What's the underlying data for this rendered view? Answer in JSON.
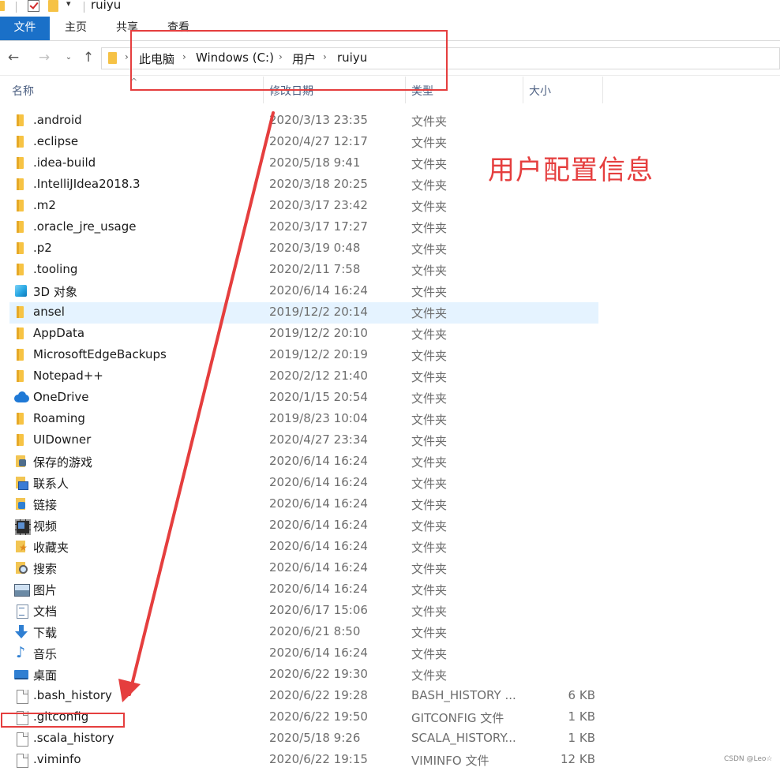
{
  "window": {
    "title": "ruiyu",
    "quick_access_glyph": "▾"
  },
  "ribbon": {
    "tabs": [
      {
        "label": "文件",
        "active": true
      },
      {
        "label": "主页"
      },
      {
        "label": "共享"
      },
      {
        "label": "查看"
      }
    ]
  },
  "nav": {
    "back_icon": "←",
    "forward_icon": "→",
    "recent_icon": "⌄",
    "up_icon": "↑",
    "separator_glyph": "›",
    "breadcrumb": [
      "此电脑",
      "Windows (C:)",
      "用户",
      "ruiyu"
    ]
  },
  "columns": {
    "name": "名称",
    "date": "修改日期",
    "type": "类型",
    "size": "大小",
    "sort_glyph": "^"
  },
  "files": [
    {
      "name": ".android",
      "date": "2020/3/13 23:35",
      "type": "文件夹",
      "size": "",
      "icon": "folder-icon"
    },
    {
      "name": ".eclipse",
      "date": "2020/4/27 12:17",
      "type": "文件夹",
      "size": "",
      "icon": "folder-icon"
    },
    {
      "name": ".idea-build",
      "date": "2020/5/18 9:41",
      "type": "文件夹",
      "size": "",
      "icon": "folder-icon"
    },
    {
      "name": ".IntelliJIdea2018.3",
      "date": "2020/3/18 20:25",
      "type": "文件夹",
      "size": "",
      "icon": "folder-icon"
    },
    {
      "name": ".m2",
      "date": "2020/3/17 23:42",
      "type": "文件夹",
      "size": "",
      "icon": "folder-icon"
    },
    {
      "name": ".oracle_jre_usage",
      "date": "2020/3/17 17:27",
      "type": "文件夹",
      "size": "",
      "icon": "folder-icon"
    },
    {
      "name": ".p2",
      "date": "2020/3/19 0:48",
      "type": "文件夹",
      "size": "",
      "icon": "folder-icon"
    },
    {
      "name": ".tooling",
      "date": "2020/2/11 7:58",
      "type": "文件夹",
      "size": "",
      "icon": "folder-icon"
    },
    {
      "name": "3D 对象",
      "date": "2020/6/14 16:24",
      "type": "文件夹",
      "size": "",
      "icon": "3d-objects-icon"
    },
    {
      "name": "ansel",
      "date": "2019/12/2 20:14",
      "type": "文件夹",
      "size": "",
      "icon": "folder-icon",
      "selected": true
    },
    {
      "name": "AppData",
      "date": "2019/12/2 20:10",
      "type": "文件夹",
      "size": "",
      "icon": "folder-icon"
    },
    {
      "name": "MicrosoftEdgeBackups",
      "date": "2019/12/2 20:19",
      "type": "文件夹",
      "size": "",
      "icon": "folder-icon"
    },
    {
      "name": "Notepad++",
      "date": "2020/2/12 21:40",
      "type": "文件夹",
      "size": "",
      "icon": "folder-icon"
    },
    {
      "name": "OneDrive",
      "date": "2020/1/15 20:54",
      "type": "文件夹",
      "size": "",
      "icon": "onedrive-cloud-icon"
    },
    {
      "name": "Roaming",
      "date": "2019/8/23 10:04",
      "type": "文件夹",
      "size": "",
      "icon": "folder-icon"
    },
    {
      "name": "UIDowner",
      "date": "2020/4/27 23:34",
      "type": "文件夹",
      "size": "",
      "icon": "folder-icon"
    },
    {
      "name": "保存的游戏",
      "date": "2020/6/14 16:24",
      "type": "文件夹",
      "size": "",
      "icon": "saved-games-icon"
    },
    {
      "name": "联系人",
      "date": "2020/6/14 16:24",
      "type": "文件夹",
      "size": "",
      "icon": "contacts-icon"
    },
    {
      "name": "链接",
      "date": "2020/6/14 16:24",
      "type": "文件夹",
      "size": "",
      "icon": "links-icon"
    },
    {
      "name": "视频",
      "date": "2020/6/14 16:24",
      "type": "文件夹",
      "size": "",
      "icon": "videos-icon"
    },
    {
      "name": "收藏夹",
      "date": "2020/6/14 16:24",
      "type": "文件夹",
      "size": "",
      "icon": "favorites-icon"
    },
    {
      "name": "搜索",
      "date": "2020/6/14 16:24",
      "type": "文件夹",
      "size": "",
      "icon": "searches-icon"
    },
    {
      "name": "图片",
      "date": "2020/6/14 16:24",
      "type": "文件夹",
      "size": "",
      "icon": "pictures-icon"
    },
    {
      "name": "文档",
      "date": "2020/6/17 15:06",
      "type": "文件夹",
      "size": "",
      "icon": "documents-icon"
    },
    {
      "name": "下载",
      "date": "2020/6/21 8:50",
      "type": "文件夹",
      "size": "",
      "icon": "downloads-icon"
    },
    {
      "name": "音乐",
      "date": "2020/6/14 16:24",
      "type": "文件夹",
      "size": "",
      "icon": "music-icon"
    },
    {
      "name": "桌面",
      "date": "2020/6/22 19:30",
      "type": "文件夹",
      "size": "",
      "icon": "desktop-icon"
    },
    {
      "name": ".bash_history",
      "date": "2020/6/22 19:28",
      "type": "BASH_HISTORY ...",
      "size": "6 KB",
      "icon": "file-icon"
    },
    {
      "name": ".gitconfig",
      "date": "2020/6/22 19:50",
      "type": "GITCONFIG 文件",
      "size": "1 KB",
      "icon": "file-icon"
    },
    {
      "name": ".scala_history",
      "date": "2020/5/18 9:26",
      "type": "SCALA_HISTORY...",
      "size": "1 KB",
      "icon": "file-icon"
    },
    {
      "name": ".viminfo",
      "date": "2020/6/22 19:15",
      "type": "VIMINFO 文件",
      "size": "12 KB",
      "icon": "file-icon"
    }
  ],
  "annotation": {
    "label": "用户配置信息",
    "color": "#e53e3e"
  },
  "colors": {
    "accent": "#1a70c8",
    "selection": "#e5f3ff",
    "folder": "#f7c343"
  },
  "watermark": "CSDN @Leo☆"
}
